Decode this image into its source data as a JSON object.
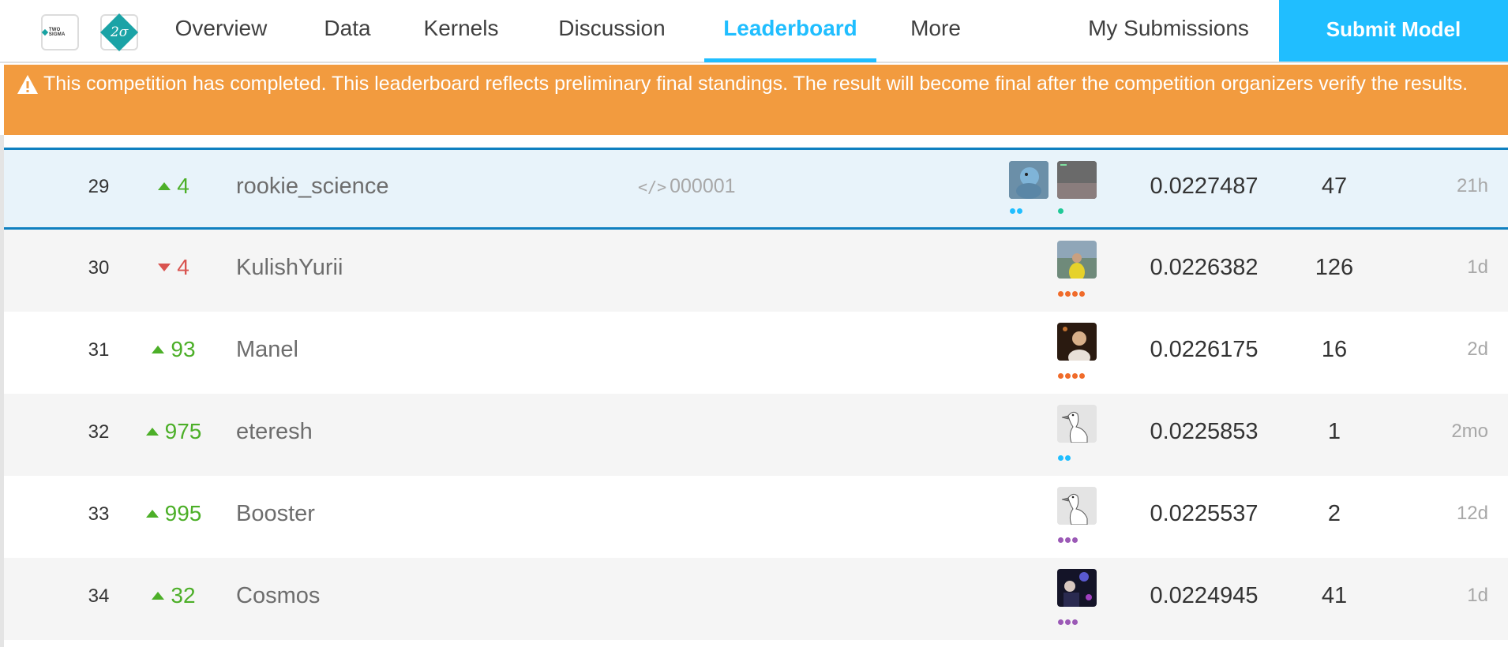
{
  "nav": {
    "logo1_text": "TWO SIGMA",
    "logo2_text": "2σ",
    "tabs": [
      "Overview",
      "Data",
      "Kernels",
      "Discussion",
      "Leaderboard",
      "More"
    ],
    "active_tab": "Leaderboard",
    "my_submissions": "My Submissions",
    "submit_label": "Submit Model",
    "accent_color": "#20beff"
  },
  "banner": {
    "text": "This competition has completed. This leaderboard reflects preliminary final standings. The result will become final after the competition organizers verify the results.",
    "icon": "warning-icon",
    "color": "#f29b3f"
  },
  "rows": [
    {
      "rank": "29",
      "direction": "up",
      "change": "4",
      "team": "rookie_science",
      "kernel": "000001",
      "score": "0.0227487",
      "entries": "47",
      "last": "21h",
      "highlight": true
    },
    {
      "rank": "30",
      "direction": "down",
      "change": "4",
      "team": "KulishYurii",
      "kernel": "",
      "score": "0.0226382",
      "entries": "126",
      "last": "1d",
      "highlight": false
    },
    {
      "rank": "31",
      "direction": "up",
      "change": "93",
      "team": "Manel",
      "kernel": "",
      "score": "0.0226175",
      "entries": "16",
      "last": "2d",
      "highlight": false
    },
    {
      "rank": "32",
      "direction": "up",
      "change": "975",
      "team": "eteresh",
      "kernel": "",
      "score": "0.0225853",
      "entries": "1",
      "last": "2mo",
      "highlight": false
    },
    {
      "rank": "33",
      "direction": "up",
      "change": "995",
      "team": "Booster",
      "kernel": "",
      "score": "0.0225537",
      "entries": "2",
      "last": "12d",
      "highlight": false
    },
    {
      "rank": "34",
      "direction": "up",
      "change": "32",
      "team": "Cosmos",
      "kernel": "",
      "score": "0.0224945",
      "entries": "41",
      "last": "1d",
      "highlight": false
    }
  ]
}
